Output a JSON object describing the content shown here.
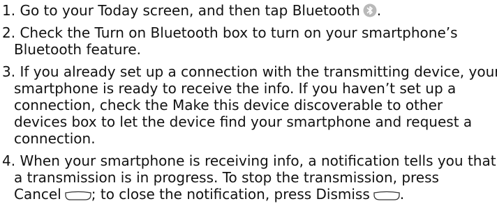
{
  "steps": [
    {
      "number": "1.",
      "lines": [
        "Go to your Today screen, and then tap Bluetooth",
        "."
      ],
      "icon": "bluetooth-icon"
    },
    {
      "number": "2.",
      "lines": [
        "Check the Turn on Bluetooth box to turn on your smartphone’s",
        "Bluetooth feature."
      ]
    },
    {
      "number": "3.",
      "lines": [
        "If you already set up a connection with the transmitting device, your",
        "smartphone is ready to receive the info. If you haven’t set up a",
        "connection, check the Make this device discoverable to other",
        "devices box to let the device find your smartphone and request a",
        "connection."
      ]
    },
    {
      "number": "4.",
      "lines": [
        "When your smartphone is receiving info, a notification tells you that",
        "a transmission is in progress. To stop the transmission, press",
        "Cancel",
        "; to close the notification, press Dismiss",
        "."
      ],
      "icons": [
        "left-softkey-icon",
        "right-softkey-icon"
      ]
    }
  ]
}
